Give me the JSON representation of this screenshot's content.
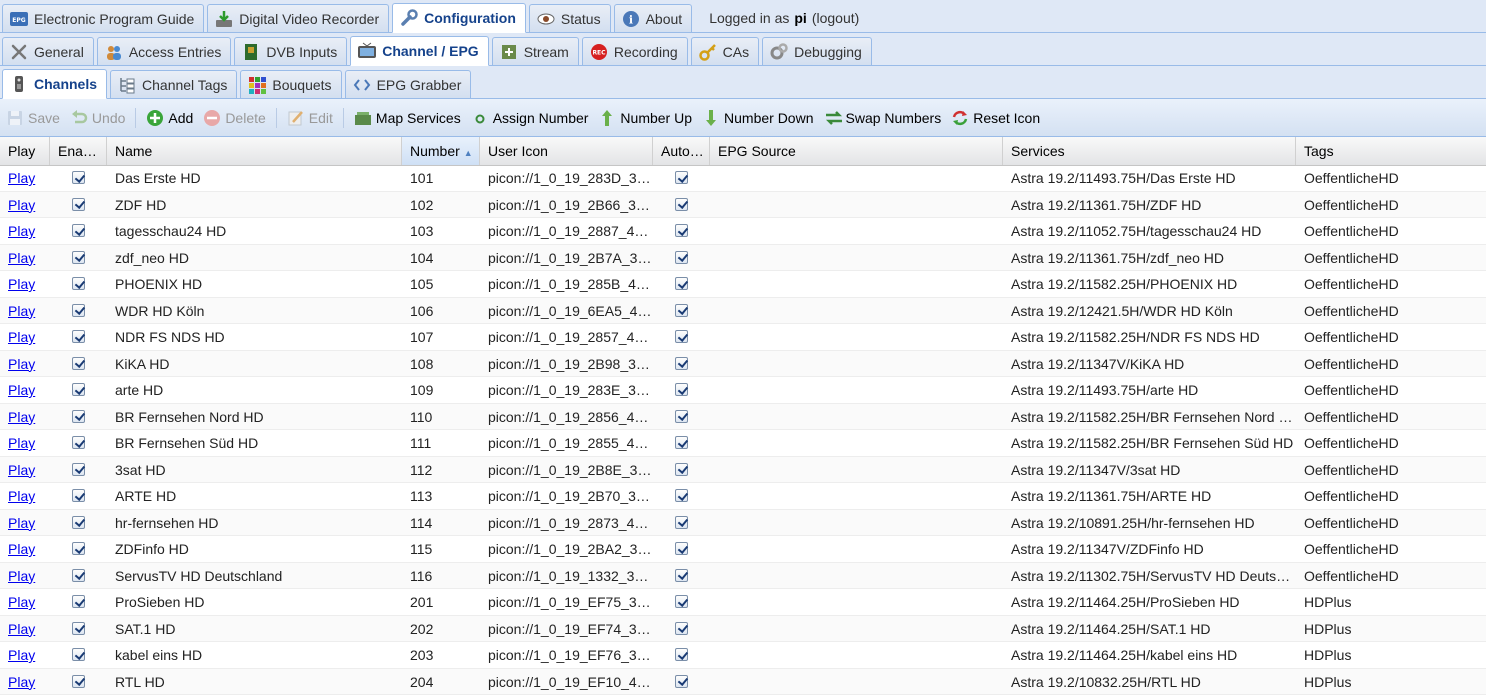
{
  "nav": {
    "tabs": [
      {
        "label": "Electronic Program Guide",
        "icon": "epg-icon"
      },
      {
        "label": "Digital Video Recorder",
        "icon": "download-icon"
      },
      {
        "label": "Configuration",
        "icon": "wrench-icon",
        "active": true
      },
      {
        "label": "Status",
        "icon": "eye-icon"
      },
      {
        "label": "About",
        "icon": "info-icon"
      }
    ],
    "login_prefix": "Logged in as",
    "username": "pi",
    "logout_label": "(logout)"
  },
  "config_tabs": [
    {
      "label": "General",
      "icon": "tools-icon"
    },
    {
      "label": "Access Entries",
      "icon": "users-icon"
    },
    {
      "label": "DVB Inputs",
      "icon": "card-icon"
    },
    {
      "label": "Channel / EPG",
      "icon": "tv-icon",
      "active": true
    },
    {
      "label": "Stream",
      "icon": "stream-icon"
    },
    {
      "label": "Recording",
      "icon": "rec-icon"
    },
    {
      "label": "CAs",
      "icon": "key-icon"
    },
    {
      "label": "Debugging",
      "icon": "gears-icon"
    }
  ],
  "channel_tabs": [
    {
      "label": "Channels",
      "icon": "remote-icon",
      "active": true
    },
    {
      "label": "Channel Tags",
      "icon": "tags-icon"
    },
    {
      "label": "Bouquets",
      "icon": "grid-icon"
    },
    {
      "label": "EPG Grabber",
      "icon": "code-icon"
    }
  ],
  "toolbar": {
    "save": "Save",
    "undo": "Undo",
    "add": "Add",
    "delete": "Delete",
    "edit": "Edit",
    "map_services": "Map Services",
    "assign_number": "Assign Number",
    "number_up": "Number Up",
    "number_down": "Number Down",
    "swap_numbers": "Swap Numbers",
    "reset_icon": "Reset Icon"
  },
  "columns": {
    "play": "Play",
    "enabled": "Ena…",
    "name": "Name",
    "number": "Number",
    "user_icon": "User Icon",
    "auto": "Auto…",
    "epg_source": "EPG Source",
    "services": "Services",
    "tags": "Tags"
  },
  "play_label": "Play",
  "rows": [
    {
      "name": "Das Erste HD",
      "number": "101",
      "icon": "picon://1_0_19_283D_3…",
      "epg": "",
      "service": "Astra 19.2/11493.75H/Das Erste HD",
      "tags": "OeffentlicheHD"
    },
    {
      "name": "ZDF HD",
      "number": "102",
      "icon": "picon://1_0_19_2B66_3…",
      "epg": "",
      "service": "Astra 19.2/11361.75H/ZDF HD",
      "tags": "OeffentlicheHD"
    },
    {
      "name": "tagesschau24 HD",
      "number": "103",
      "icon": "picon://1_0_19_2887_4…",
      "epg": "",
      "service": "Astra 19.2/11052.75H/tagesschau24 HD",
      "tags": "OeffentlicheHD"
    },
    {
      "name": "zdf_neo HD",
      "number": "104",
      "icon": "picon://1_0_19_2B7A_3…",
      "epg": "",
      "service": "Astra 19.2/11361.75H/zdf_neo HD",
      "tags": "OeffentlicheHD"
    },
    {
      "name": "PHOENIX HD",
      "number": "105",
      "icon": "picon://1_0_19_285B_4…",
      "epg": "",
      "service": "Astra 19.2/11582.25H/PHOENIX HD",
      "tags": "OeffentlicheHD"
    },
    {
      "name": "WDR HD Köln",
      "number": "106",
      "icon": "picon://1_0_19_6EA5_4…",
      "epg": "",
      "service": "Astra 19.2/12421.5H/WDR HD Köln",
      "tags": "OeffentlicheHD"
    },
    {
      "name": "NDR FS NDS HD",
      "number": "107",
      "icon": "picon://1_0_19_2857_4…",
      "epg": "",
      "service": "Astra 19.2/11582.25H/NDR FS NDS HD",
      "tags": "OeffentlicheHD"
    },
    {
      "name": "KiKA HD",
      "number": "108",
      "icon": "picon://1_0_19_2B98_3…",
      "epg": "",
      "service": "Astra 19.2/11347V/KiKA HD",
      "tags": "OeffentlicheHD"
    },
    {
      "name": "arte HD",
      "number": "109",
      "icon": "picon://1_0_19_283E_3…",
      "epg": "",
      "service": "Astra 19.2/11493.75H/arte HD",
      "tags": "OeffentlicheHD"
    },
    {
      "name": "BR Fernsehen Nord HD",
      "number": "110",
      "icon": "picon://1_0_19_2856_4…",
      "epg": "",
      "service": "Astra 19.2/11582.25H/BR Fernsehen Nord …",
      "tags": "OeffentlicheHD"
    },
    {
      "name": "BR Fernsehen Süd HD",
      "number": "111",
      "icon": "picon://1_0_19_2855_4…",
      "epg": "",
      "service": "Astra 19.2/11582.25H/BR Fernsehen Süd HD",
      "tags": "OeffentlicheHD"
    },
    {
      "name": "3sat HD",
      "number": "112",
      "icon": "picon://1_0_19_2B8E_3…",
      "epg": "",
      "service": "Astra 19.2/11347V/3sat HD",
      "tags": "OeffentlicheHD"
    },
    {
      "name": "ARTE HD",
      "number": "113",
      "icon": "picon://1_0_19_2B70_3…",
      "epg": "",
      "service": "Astra 19.2/11361.75H/ARTE HD",
      "tags": "OeffentlicheHD"
    },
    {
      "name": "hr-fernsehen HD",
      "number": "114",
      "icon": "picon://1_0_19_2873_4…",
      "epg": "",
      "service": "Astra 19.2/10891.25H/hr-fernsehen HD",
      "tags": "OeffentlicheHD"
    },
    {
      "name": "ZDFinfo HD",
      "number": "115",
      "icon": "picon://1_0_19_2BA2_3…",
      "epg": "",
      "service": "Astra 19.2/11347V/ZDFinfo HD",
      "tags": "OeffentlicheHD"
    },
    {
      "name": "ServusTV HD Deutschland",
      "number": "116",
      "icon": "picon://1_0_19_1332_3…",
      "epg": "",
      "service": "Astra 19.2/11302.75H/ServusTV HD Deutsc…",
      "tags": "OeffentlicheHD"
    },
    {
      "name": "ProSieben HD",
      "number": "201",
      "icon": "picon://1_0_19_EF75_3…",
      "epg": "",
      "service": "Astra 19.2/11464.25H/ProSieben HD",
      "tags": "HDPlus"
    },
    {
      "name": "SAT.1 HD",
      "number": "202",
      "icon": "picon://1_0_19_EF74_3…",
      "epg": "",
      "service": "Astra 19.2/11464.25H/SAT.1 HD",
      "tags": "HDPlus"
    },
    {
      "name": "kabel eins HD",
      "number": "203",
      "icon": "picon://1_0_19_EF76_3…",
      "epg": "",
      "service": "Astra 19.2/11464.25H/kabel eins HD",
      "tags": "HDPlus"
    },
    {
      "name": "RTL HD",
      "number": "204",
      "icon": "picon://1_0_19_EF10_4…",
      "epg": "",
      "service": "Astra 19.2/10832.25H/RTL HD",
      "tags": "HDPlus"
    }
  ]
}
